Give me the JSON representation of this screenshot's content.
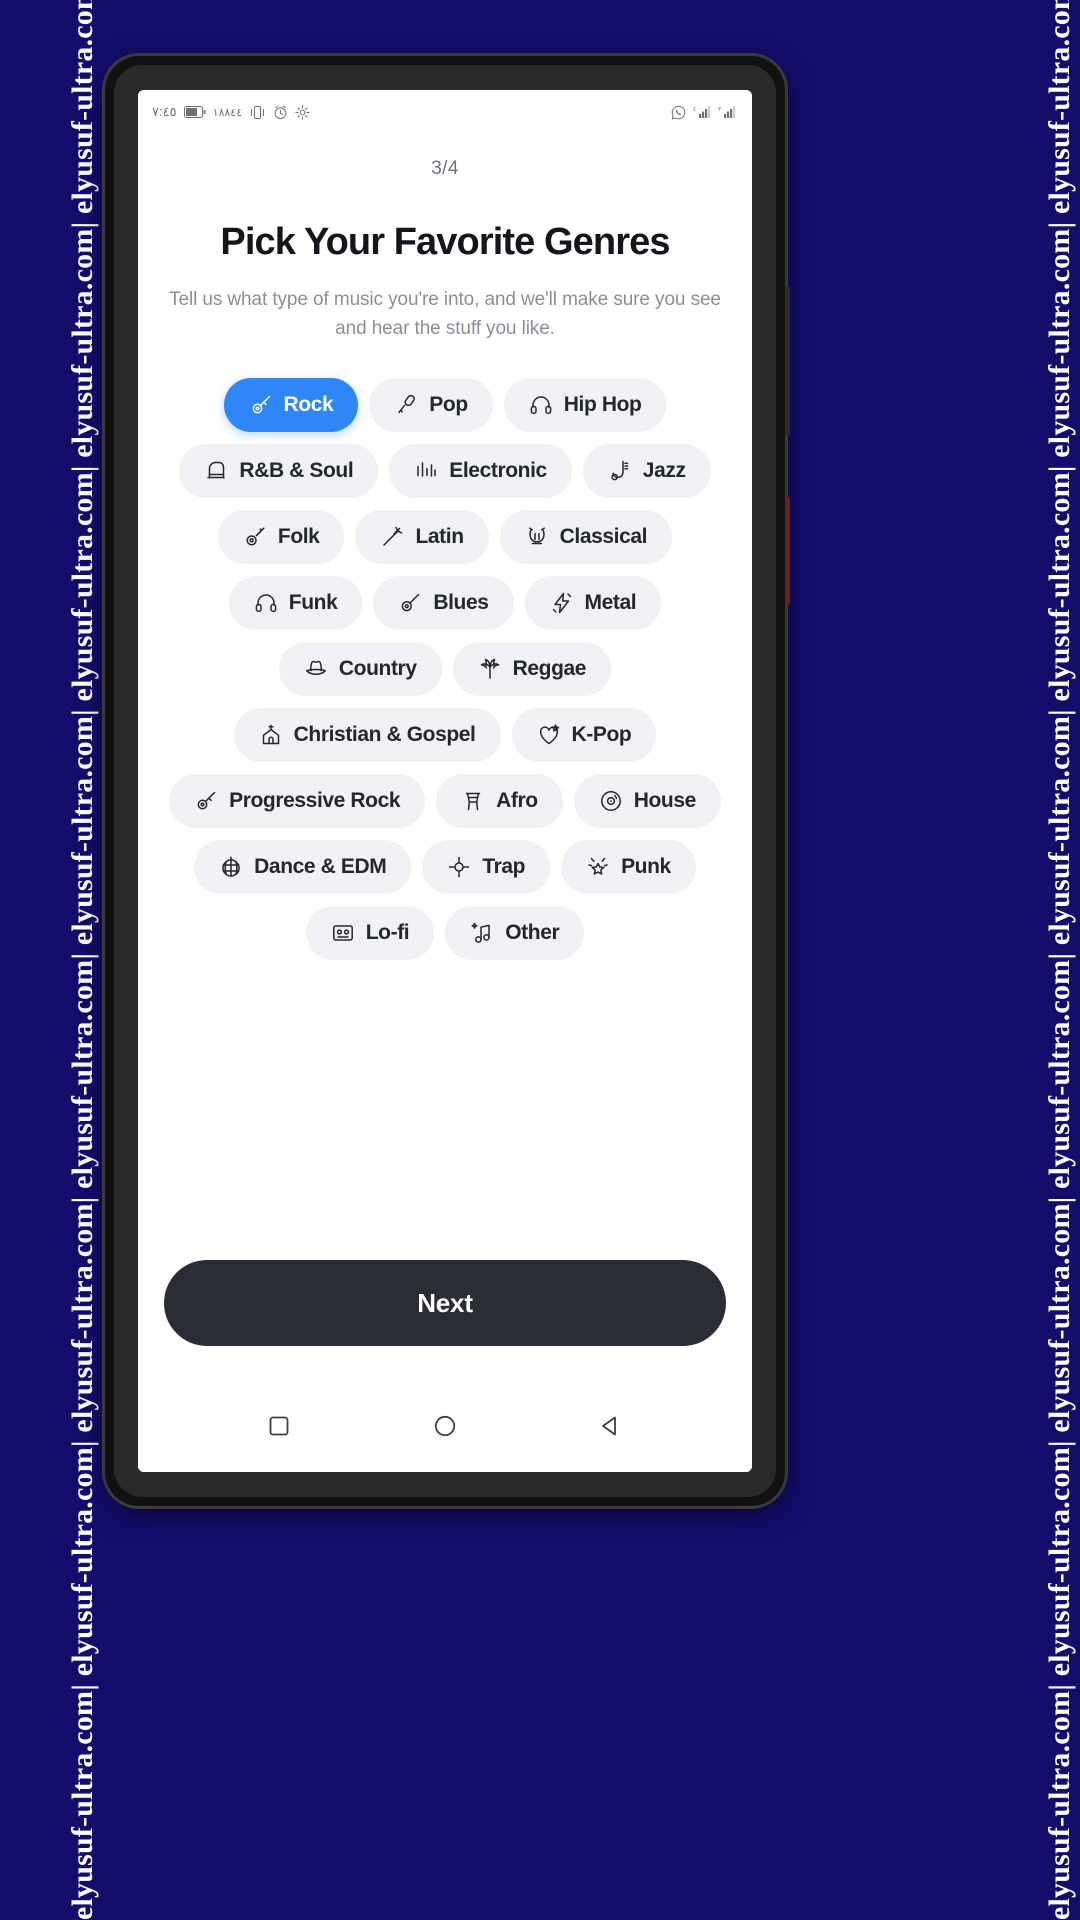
{
  "watermark": {
    "text": "elyusuf-ultra.com| elyusuf-ultra.com| elyusuf-ultra.com| elyusuf-ultra.com| elyusuf-ultra.com| elyusuf-ultra.com| elyusuf-ultra.com| elyusuf-ultra.com| elyusuf-ultra.com|"
  },
  "status_bar": {
    "clock": "٧:٤٥",
    "left_icons": [
      "battery-icon",
      "signal-text-icon",
      "vibrate-icon",
      "alarm-icon",
      "settings-icon"
    ],
    "right_icons": [
      "whatsapp-icon",
      "signal-bars-icon",
      "signal-bars-icon"
    ]
  },
  "screen": {
    "step_indicator": "3/4",
    "title": "Pick Your Favorite Genres",
    "subtitle": "Tell us what type of music you're into, and we'll make sure you see and hear the stuff you like.",
    "next_label": "Next"
  },
  "colors": {
    "selected_chip": "#2f86f6",
    "chip_background": "#f0f1f4",
    "next_button": "#2b2d34",
    "title_text": "#14161d",
    "subtitle_text": "#8a8e9b",
    "watermark_background": "#140d6b"
  },
  "genres": [
    {
      "label": "Rock",
      "icon": "electric-guitar-icon",
      "selected": true
    },
    {
      "label": "Pop",
      "icon": "microphone-icon",
      "selected": false
    },
    {
      "label": "Hip Hop",
      "icon": "headphones-icon",
      "selected": false
    },
    {
      "label": "R&B & Soul",
      "icon": "piano-icon",
      "selected": false
    },
    {
      "label": "Electronic",
      "icon": "equalizer-icon",
      "selected": false
    },
    {
      "label": "Jazz",
      "icon": "saxophone-icon",
      "selected": false
    },
    {
      "label": "Folk",
      "icon": "banjo-icon",
      "selected": false
    },
    {
      "label": "Latin",
      "icon": "maracas-icon",
      "selected": false
    },
    {
      "label": "Classical",
      "icon": "lyre-icon",
      "selected": false
    },
    {
      "label": "Funk",
      "icon": "headphones-icon",
      "selected": false
    },
    {
      "label": "Blues",
      "icon": "acoustic-guitar-icon",
      "selected": false
    },
    {
      "label": "Metal",
      "icon": "lightning-icon",
      "selected": false
    },
    {
      "label": "Country",
      "icon": "cowboy-hat-icon",
      "selected": false
    },
    {
      "label": "Reggae",
      "icon": "palm-leaf-icon",
      "selected": false
    },
    {
      "label": "Christian & Gospel",
      "icon": "church-icon",
      "selected": false
    },
    {
      "label": "K-Pop",
      "icon": "heart-star-icon",
      "selected": false
    },
    {
      "label": "Progressive Rock",
      "icon": "electric-guitar-icon",
      "selected": false
    },
    {
      "label": "Afro",
      "icon": "djembe-drum-icon",
      "selected": false
    },
    {
      "label": "House",
      "icon": "vinyl-record-icon",
      "selected": false
    },
    {
      "label": "Dance & EDM",
      "icon": "disco-ball-icon",
      "selected": false
    },
    {
      "label": "Trap",
      "icon": "crosshair-icon",
      "selected": false
    },
    {
      "label": "Punk",
      "icon": "safety-pin-star-icon",
      "selected": false
    },
    {
      "label": "Lo-fi",
      "icon": "cassette-icon",
      "selected": false
    },
    {
      "label": "Other",
      "icon": "music-note-sparkle-icon",
      "selected": false
    }
  ],
  "nav_bar": {
    "buttons": [
      {
        "name": "recents-button",
        "icon": "square-icon"
      },
      {
        "name": "home-button",
        "icon": "circle-icon"
      },
      {
        "name": "back-button",
        "icon": "triangle-back-icon"
      }
    ]
  }
}
